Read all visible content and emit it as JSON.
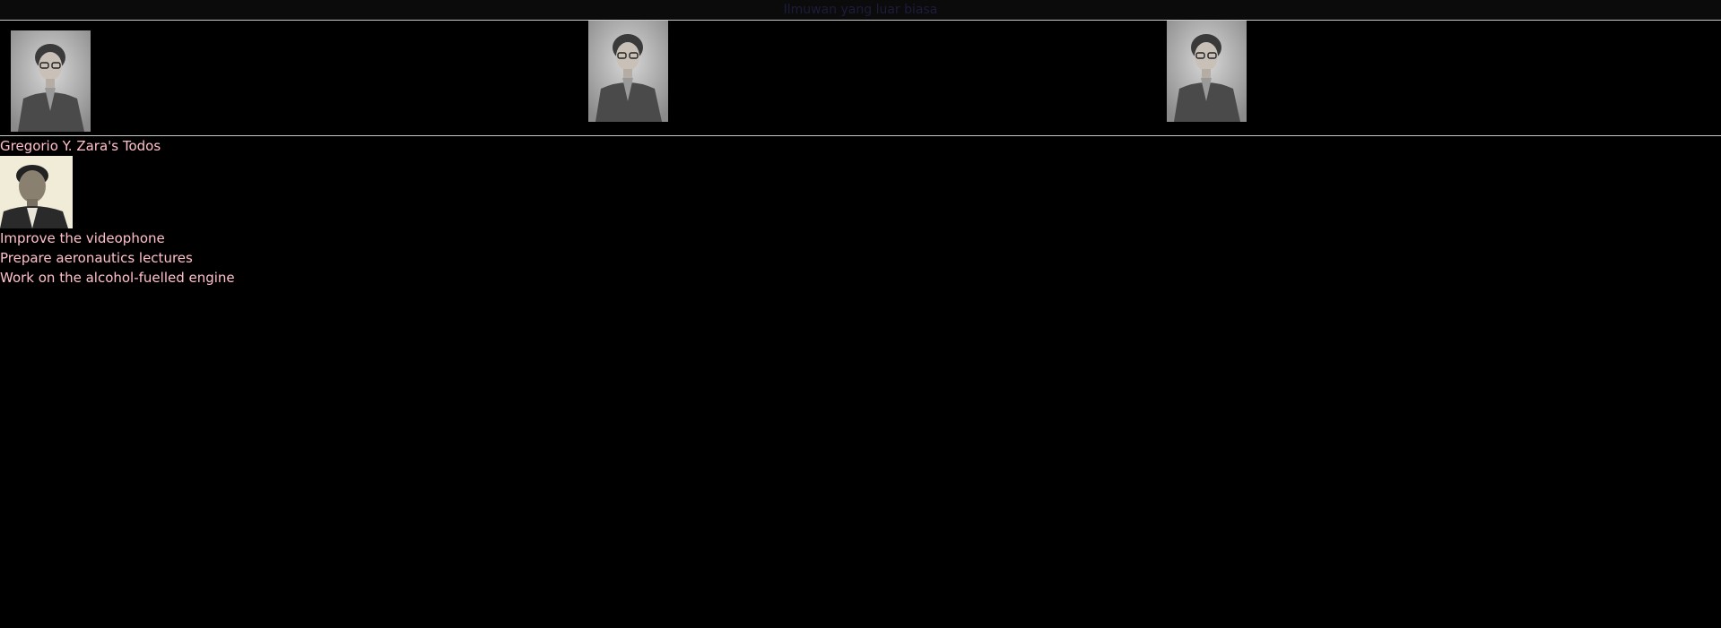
{
  "header": {
    "title": "Ilmuwan yang luar biasa"
  },
  "gallery": {
    "images": [
      {
        "icon": "katherine-johnson-portrait"
      },
      {
        "icon": "katherine-johnson-portrait"
      },
      {
        "icon": "katherine-johnson-portrait"
      }
    ]
  },
  "profile": {
    "heading": "Gregorio Y. Zara's Todos",
    "avatar_icon": "gregorio-zara-portrait"
  },
  "todos": [
    {
      "label": "Improve the videophone"
    },
    {
      "label": "Prepare aeronautics lectures"
    },
    {
      "label": "Work on the alcohol-fuelled engine"
    }
  ],
  "colors": {
    "background": "#000000",
    "text": "#ffc0cb",
    "title": "#1c1c3c",
    "divider": "#c8c8c8"
  }
}
